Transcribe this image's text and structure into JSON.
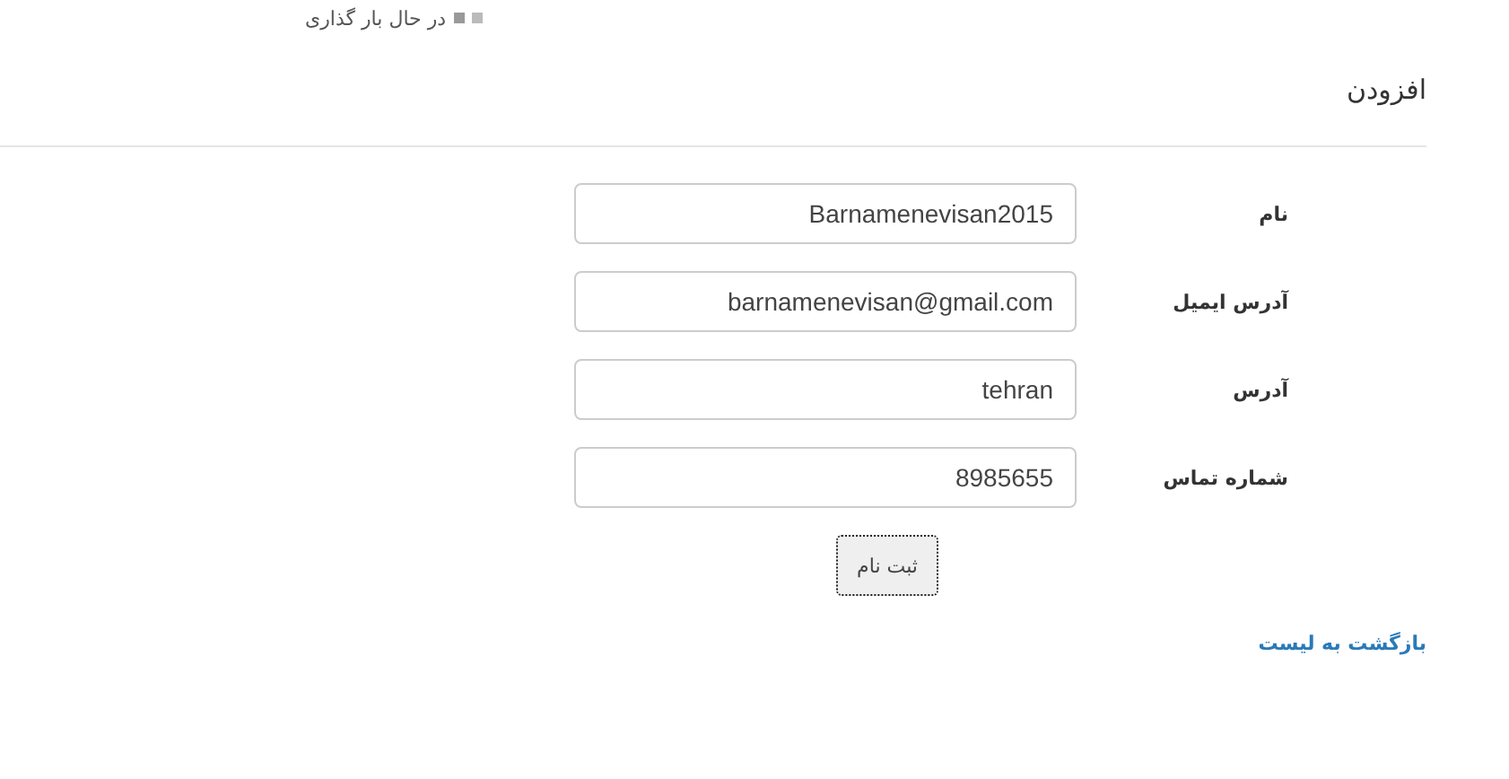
{
  "loading": {
    "text": "در حال بار گذاری"
  },
  "page": {
    "title": "افزودن"
  },
  "form": {
    "fields": [
      {
        "label": "نام",
        "value": "Barnamenevisan2015"
      },
      {
        "label": "آدرس ایمیل",
        "value": "barnamenevisan@gmail.com"
      },
      {
        "label": "آدرس",
        "value": "tehran"
      },
      {
        "label": "شماره تماس",
        "value": "8985655"
      }
    ],
    "submit": "ثبت نام"
  },
  "back_link": "بازگشت به لیست"
}
